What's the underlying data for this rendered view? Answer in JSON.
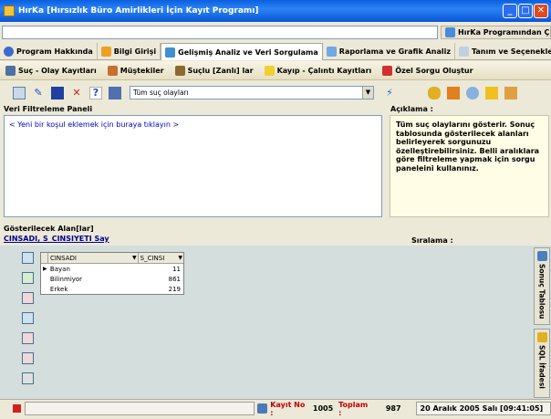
{
  "window": {
    "title": "HırKa [Hırsızlık Büro Amirlikleri İçin Kayıt Programı]",
    "min": "_",
    "max": "□",
    "close": "✕"
  },
  "topbar": {
    "field_value": "",
    "exit_label": "HırKa Programından Çık"
  },
  "main_tabs": [
    {
      "label": "Program Hakkında"
    },
    {
      "label": "Bilgi Girişi"
    },
    {
      "label": "Gelişmiş Analiz ve Veri Sorgulama"
    },
    {
      "label": "Raporlama ve Grafik Analiz"
    },
    {
      "label": "Tanım ve Seçenekler"
    }
  ],
  "sub_tabs": [
    {
      "label": "Suç - Olay Kayıtları"
    },
    {
      "label": "Müştekiler"
    },
    {
      "label": "Suçlu [Zanlı] lar"
    },
    {
      "label": "Kayıp - Çalıntı Kayıtları"
    },
    {
      "label": "Özel Sorgu Oluştur"
    }
  ],
  "toolbar": {
    "query_select": "Tüm suç olayları",
    "help_label": "?"
  },
  "filter_panel": {
    "title": "Veri Filtreleme Paneli",
    "add_condition": "< Yeni bir koşul eklemek için buraya tıklayın >"
  },
  "description": {
    "title": "Açıklama :",
    "text": "Tüm suç olaylarını gösterir. Sonuç tablosunda gösterilecek alanları belirleyerek sorgunuzu özelleştirebilirsiniz. Belli aralıklara göre filtreleme yapmak için sorgu paneleini kullanınız."
  },
  "fields": {
    "title": "Gösterilecek Alan[lar]",
    "value": "CINSADI, S_CINSIYETI Say"
  },
  "sort": {
    "label": "Sıralama :"
  },
  "grid": {
    "columns": [
      "CINSADI",
      "S_CINSI"
    ],
    "rows": [
      {
        "name": "Bayan",
        "count": "11"
      },
      {
        "name": "Bilinmiyor",
        "count": "861"
      },
      {
        "name": "Erkek",
        "count": "219"
      }
    ]
  },
  "side_tabs": {
    "result": "Sonuç Tablosu",
    "sql": "SQL İfadesi"
  },
  "status": {
    "record_label": "Kayıt No :",
    "record_no": "1005",
    "total_label": "Toplam :",
    "total": "987",
    "datetime": "20 Aralık 2005 Salı [09:41:05]"
  },
  "colors": {
    "title": "#0a5fe0",
    "link": "#0000c0",
    "desc_bg": "#fffde6"
  }
}
